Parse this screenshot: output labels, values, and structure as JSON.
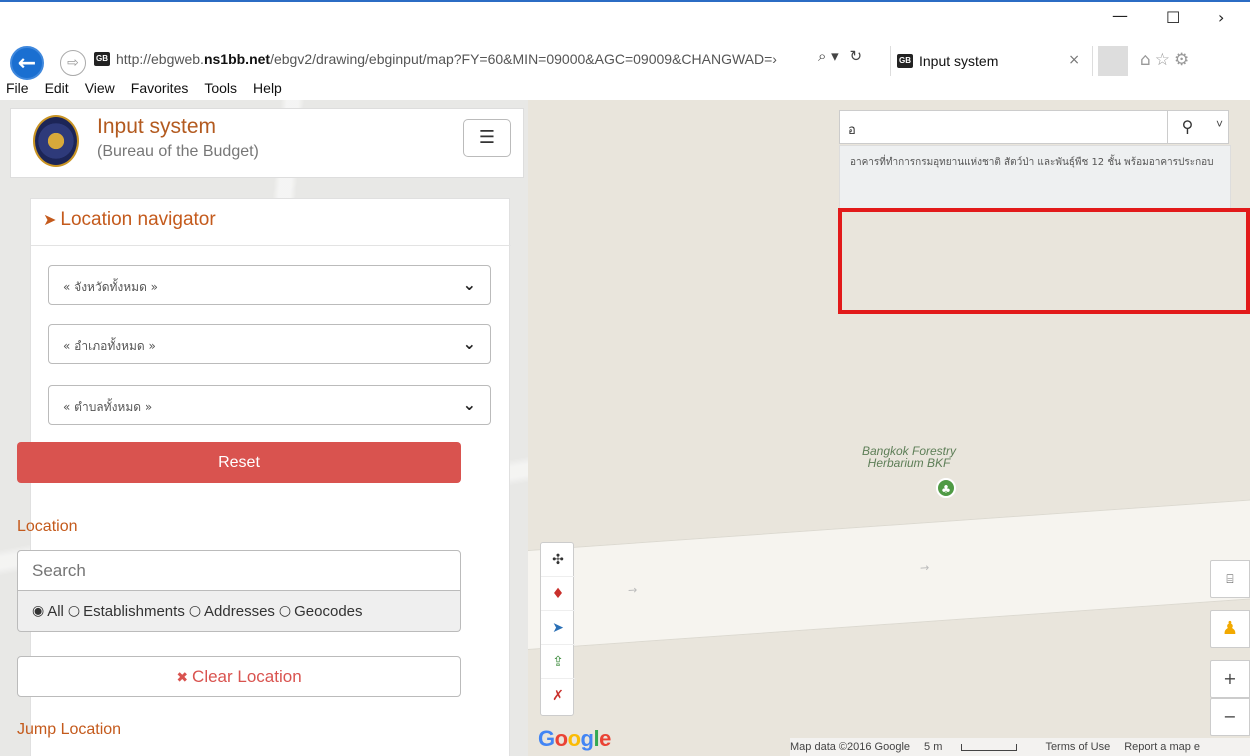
{
  "browser": {
    "window_controls": {
      "minimize": "—",
      "maximize": "☐",
      "chevron": "›"
    },
    "url_domain": "ns1bb.net",
    "url_prefix": "http://ebgweb.",
    "url_suffix": "/ebgv2/drawing/ebginput/map?FY=60&MIN=09000&AGC=09009&CHANGWAD=›",
    "favicon_text": "GB",
    "tab_title": "Input system",
    "tab_close": "×",
    "nav_icons": {
      "back": "back-arrow-icon",
      "forward": "forward-arrow-icon",
      "search": "search-dropdown-icon",
      "refresh": "refresh-icon",
      "home": "home-icon",
      "favorites": "star-icon",
      "settings": "gear-icon"
    },
    "menu": [
      "File",
      "Edit",
      "View",
      "Favorites",
      "Tools",
      "Help"
    ]
  },
  "header": {
    "title": "Input system",
    "subtitle": "(Bureau of the Budget)"
  },
  "navigator": {
    "heading": "Location navigator",
    "province_select": "« จังหวัดทั้งหมด »",
    "district_select": "« อำเภอทั้งหมด »",
    "subdistrict_select": "« ตำบลทั้งหมด »",
    "reset_label": "Reset"
  },
  "location": {
    "label": "Location",
    "search_placeholder": "Search",
    "filter_options": [
      "All",
      "Establishments",
      "Addresses",
      "Geocodes"
    ],
    "selected_filter": "All",
    "clear_label": "Clear Location",
    "jump_label": "Jump Location"
  },
  "map": {
    "search_value": "อ",
    "suggestion": "อาคารที่ทำการกรมอุทยานแห่งชาติ สัตว์ป่า และพันธุ์พืช 12 ชั้น พร้อมอาคารประกอบ",
    "poi_label": "Bangkok Forestry Herbarium BKF",
    "logo": "Google",
    "attribution": "Map data ©2016 Google",
    "scale": "5 m",
    "terms": "Terms of Use",
    "report": "Report a map e",
    "colors": {
      "accent": "#c45a1c",
      "danger": "#d9534f",
      "highlight": "#e21a1a",
      "map_bg": "#e9e5dc"
    }
  }
}
